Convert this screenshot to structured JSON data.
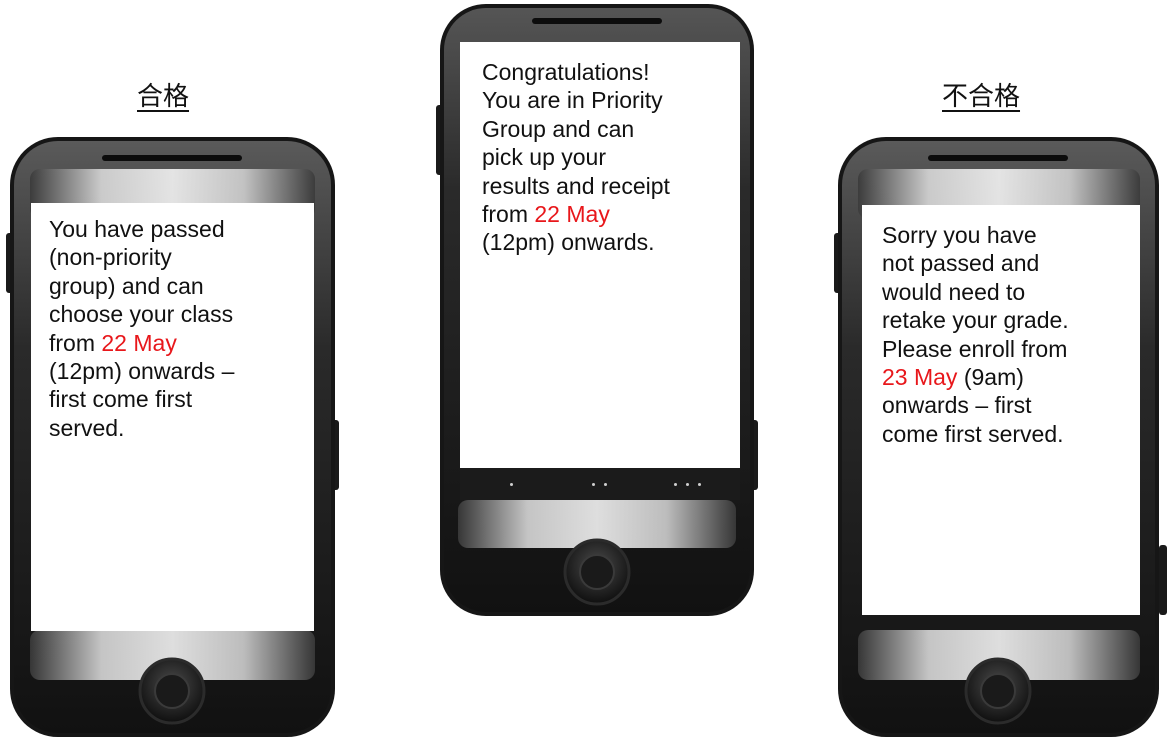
{
  "captions": {
    "pass": "合格",
    "fail": "不合格"
  },
  "phones": {
    "left": {
      "message_lines": [
        "You have passed",
        "(non-priority",
        "group) and can",
        "choose your class"
      ],
      "line5_pre": "from ",
      "line5_date": "22 May",
      "message_lines_after": [
        "(12pm) onwards –",
        "first come first",
        "served."
      ]
    },
    "center": {
      "message_lines": [
        "Congratulations!",
        "You are in Priority",
        "Group and can",
        "pick up your",
        "results and receipt"
      ],
      "line6_pre": "from ",
      "line6_date": "22 May",
      "message_lines_after": [
        "(12pm) onwards."
      ]
    },
    "right": {
      "message_lines": [
        "Sorry you have",
        "not passed and",
        "would need to",
        "retake your grade.",
        "Please enroll from"
      ],
      "line6_date": "23 May",
      "line6_post": " (9am)",
      "message_lines_after": [
        "onwards – first",
        "come first served."
      ]
    }
  },
  "colors": {
    "highlight": "#e8171b",
    "phone_body": "#1c1c1c"
  }
}
